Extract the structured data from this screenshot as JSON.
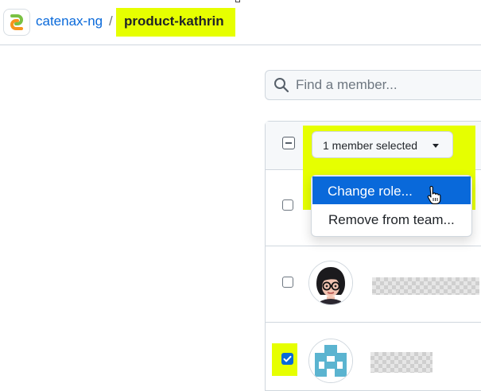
{
  "header": {
    "org_name": "catenax-ng",
    "separator": "/",
    "team_name": "product-kathrin"
  },
  "search": {
    "placeholder": "Find a member..."
  },
  "bulk_actions": {
    "selected_label": "1 member selected",
    "menu": {
      "items": [
        {
          "label": "Change role...",
          "state": "highlighted"
        },
        {
          "label": "Remove from team..."
        }
      ]
    }
  },
  "members": [
    {
      "checked": false,
      "avatar": "hidden-by-menu"
    },
    {
      "checked": false,
      "avatar": "cartoon-woman-glasses",
      "name_redacted": true
    },
    {
      "checked": true,
      "avatar": "blue-cross-identicon",
      "name_redacted": true
    }
  ],
  "colors": {
    "accent": "#0969da",
    "highlight": "#e6ff00",
    "border": "#d0d7de",
    "header_bg": "#f6f8fa"
  },
  "icons": {
    "search": "search-icon",
    "caret": "triangle-down-icon",
    "checkmark": "check-icon",
    "cursor": "hand-pointer-cursor-icon",
    "indeterminate": "minus-square-icon"
  }
}
